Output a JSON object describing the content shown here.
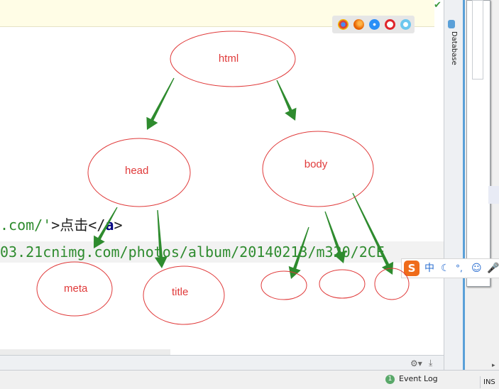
{
  "editor": {
    "code_line1": {
      "seg1": ".com/'",
      "seg2": ">",
      "seg3": "点击",
      "seg4": "</",
      "seg5": "a",
      "seg6": ">"
    },
    "code_line2": {
      "text": "03.21cnimg.com/photos/album/20140213/m320/2CE"
    }
  },
  "tool_window": {
    "database_label": "Database"
  },
  "browser_icons": [
    "chrome-icon",
    "firefox-icon",
    "safari-icon",
    "opera-icon",
    "ie-icon"
  ],
  "status": {
    "event_log_count": "1",
    "event_log_label": "Event Log",
    "mode": "INS"
  },
  "ime": {
    "chinese_mode": "中",
    "punct": "°,"
  },
  "diagram": {
    "nodes": [
      {
        "id": "html",
        "label": "html"
      },
      {
        "id": "head",
        "label": "head"
      },
      {
        "id": "body",
        "label": "body"
      },
      {
        "id": "meta",
        "label": "meta"
      },
      {
        "id": "title",
        "label": "title"
      },
      {
        "id": "child1",
        "label": ""
      },
      {
        "id": "child2",
        "label": ""
      },
      {
        "id": "child3",
        "label": ""
      }
    ],
    "edges": [
      [
        "html",
        "head"
      ],
      [
        "html",
        "body"
      ],
      [
        "head",
        "meta"
      ],
      [
        "head",
        "title"
      ],
      [
        "body",
        "child1"
      ],
      [
        "body",
        "child2"
      ],
      [
        "body",
        "child3"
      ]
    ],
    "ellipse_color": "#e03a3a",
    "arrow_color": "#2e8b2e"
  }
}
